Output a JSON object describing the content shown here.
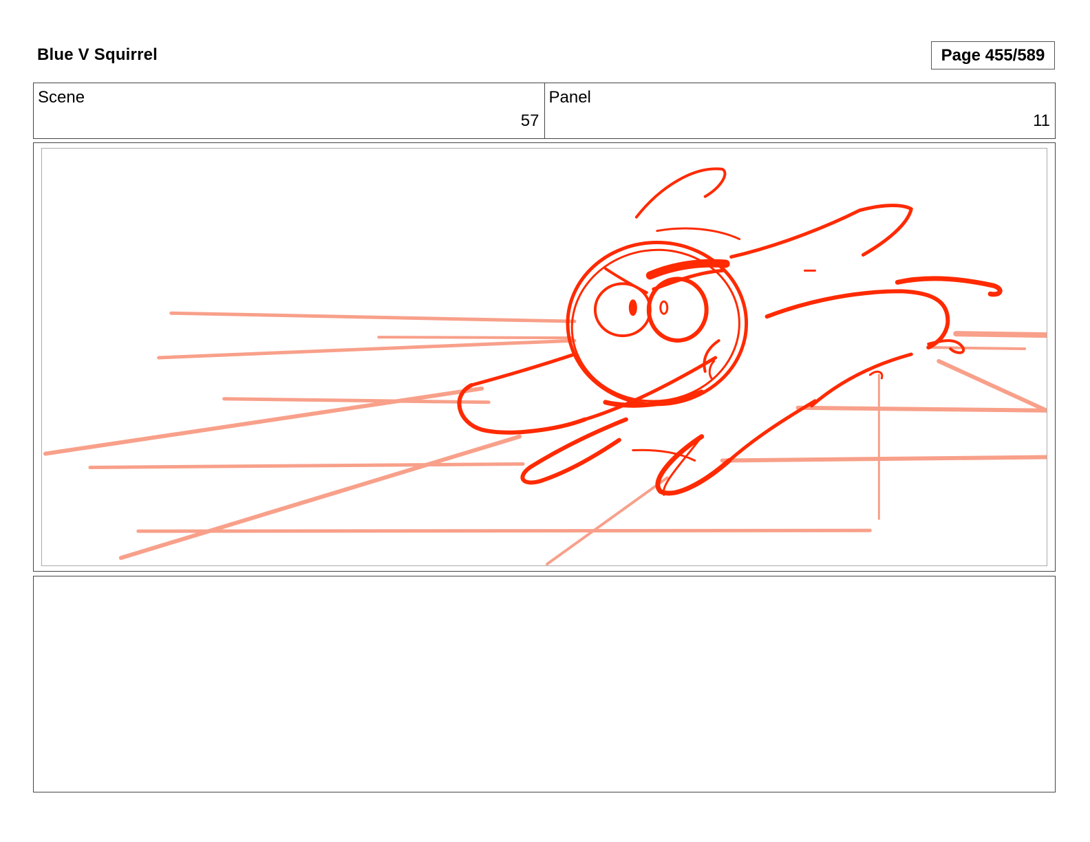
{
  "header": {
    "title": "Blue V Squirrel",
    "page_label": "Page 455/589"
  },
  "info": {
    "scene_label": "Scene",
    "scene_value": "57",
    "panel_label": "Panel",
    "panel_value": "11"
  },
  "sketch": {
    "stroke_color": "#ff2a00",
    "speedline_color": "#f8a08a"
  }
}
